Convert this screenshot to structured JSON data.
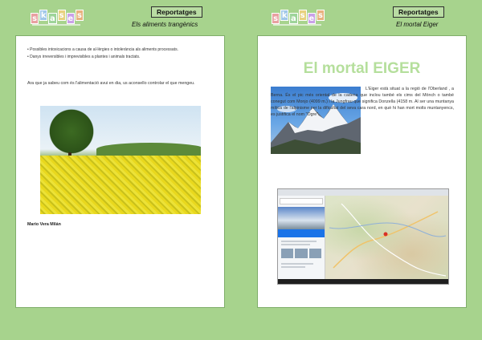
{
  "left": {
    "logo": {
      "letters": [
        "s",
        "k",
        "a",
        "s",
        "e",
        "s"
      ],
      "colors": [
        "#e8a1a1",
        "#a1c8e8",
        "#9ed49a",
        "#e8d17f",
        "#c9a1e8",
        "#e8b27f"
      ]
    },
    "section": "Reportatges",
    "subtitle": "Els aliments trangènics",
    "bullets": [
      "• Possibles intoxicacions a causa de al·lèrgies o intolerància als aliments processats.",
      "• Danys irreversibles i imprevisibles a plantes i animals tractats."
    ],
    "paragraph": "Ara que ja sabeu com és l'alimentació avui en dia, us aconsello controlar el que mengeu.",
    "author": "Mario Vera Milán"
  },
  "right": {
    "logo": {
      "letters": [
        "s",
        "k",
        "a",
        "s",
        "e",
        "s"
      ],
      "colors": [
        "#e8a1a1",
        "#a1c8e8",
        "#9ed49a",
        "#e8d17f",
        "#c9a1e8",
        "#e8b27f"
      ]
    },
    "section": "Reportatges",
    "subtitle": "El mortal Eiger",
    "title": "El mortal EIGER",
    "paragraph": "L'Eiger està situat a la regió de l'Oberland , a Berna. És el pic més oriental de la cadena que inclou també els cims del Mönch o també conegut com Monjo (4099 m.) i la Jungfrau que significa Donzella (4158 m. Al ser una muntanya mítica de l'alpinisme per la dificultat del seva cara nord, en què hi han mort molts muntanyencs, es justifica el nom \"Ogre\"."
  },
  "colors": {
    "background": "#a7d38d",
    "title_green": "#b5df9c"
  }
}
